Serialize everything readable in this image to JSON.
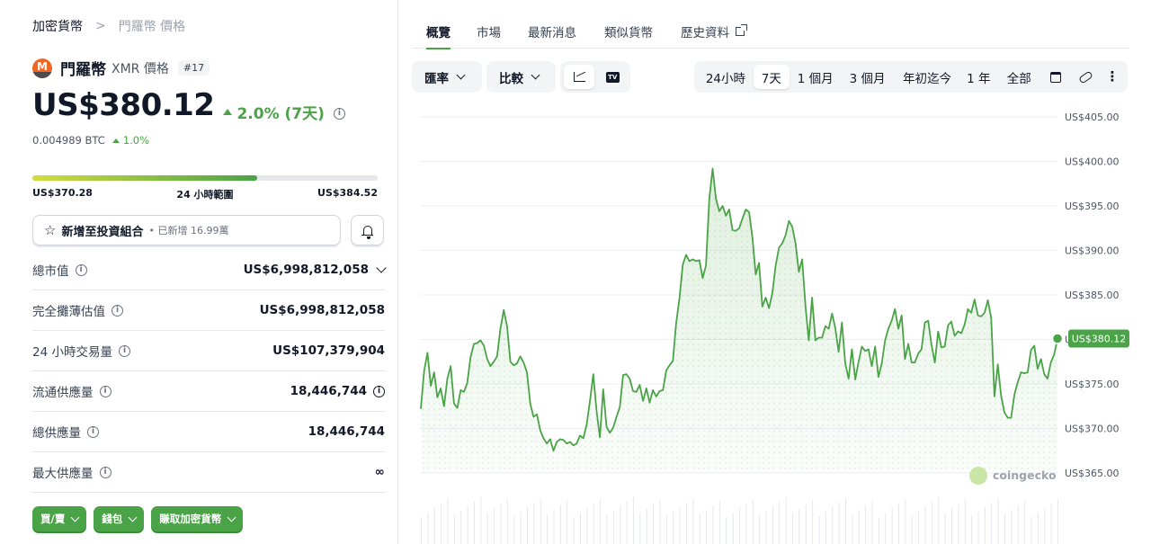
{
  "breadcrumb": {
    "home": "加密貨幣",
    "separator": ">",
    "current": "門羅幣 價格"
  },
  "coin": {
    "name": "門羅幣",
    "symbol": "XMR 價格",
    "rank": "#17",
    "price": "US$380.12",
    "change": "2.0% (7天)",
    "change_direction": "up",
    "btc_price": "0.004989 BTC",
    "btc_change": "1.0%"
  },
  "range": {
    "low": "US$370.28",
    "label": "24 小時範圍",
    "high": "US$384.52",
    "position_fraction": 0.65
  },
  "portfolio": {
    "label": "新增至投資組合",
    "sub": "• 已新增 16.99萬"
  },
  "stats": [
    {
      "label": "總市值",
      "value": "US$6,998,812,058"
    },
    {
      "label": "完全攤薄估值",
      "value": "US$6,998,812,058"
    },
    {
      "label": "24 小時交易量",
      "value": "US$107,379,904"
    },
    {
      "label": "流通供應量",
      "value": "18,446,744"
    },
    {
      "label": "總供應量",
      "value": "18,446,744"
    },
    {
      "label": "最大供應量",
      "value": "∞"
    }
  ],
  "ctas": [
    "買/賣",
    "錢包",
    "賺取加密貨幣"
  ],
  "tabs": [
    "概覽",
    "市場",
    "最新消息",
    "類似貨幣",
    "歷史資料"
  ],
  "active_tab": "概覽",
  "chart_controls": {
    "currency": "匯率",
    "compare": "比較",
    "ranges": [
      "24小時",
      "7天",
      "1 個月",
      "3 個月",
      "年初迄今",
      "1 年",
      "全部"
    ],
    "active_range": "7天"
  },
  "colors": {
    "accent": "#4aa346",
    "text": "#111827",
    "muted": "#6b7280"
  },
  "icons": {
    "chart_type_line": "line-chart-icon",
    "chart_type_tv": "tradingview-icon",
    "calendar": "calendar-icon",
    "share": "link-icon",
    "more": "more-dots-icon"
  },
  "chart_data": {
    "type": "area",
    "ylim": [
      365,
      405
    ],
    "y_ticks": [
      "US$405.00",
      "US$400.00",
      "US$395.00",
      "US$390.00",
      "US$385.00",
      "US$380.00",
      "US$375.00",
      "US$370.00",
      "US$365.00"
    ],
    "y_tick_values": [
      405,
      400,
      395,
      390,
      385,
      380,
      375,
      370,
      365
    ],
    "current_label": "US$380.12",
    "watermark": "coingecko",
    "x_labels": [],
    "values": [
      372.2,
      376.5,
      378.5,
      374.8,
      376.3,
      373.5,
      374.5,
      372.5,
      375.6,
      377.0,
      372.8,
      372.3,
      374.3,
      374.1,
      375.1,
      378.0,
      379.5,
      379.6,
      379.9,
      379.3,
      377.8,
      377.0,
      377.5,
      378.1,
      381.2,
      383.3,
      381.5,
      377.5,
      377.1,
      377.3,
      378.1,
      377.4,
      376.3,
      372.8,
      371.3,
      371.6,
      369.8,
      368.9,
      368.3,
      368.8,
      367.5,
      368.5,
      368.8,
      368.7,
      368.3,
      368.5,
      368.1,
      368.3,
      369.2,
      368.9,
      370.4,
      373.1,
      376.1,
      372.0,
      369.0,
      374.4,
      370.2,
      369.5,
      370.1,
      371.3,
      372.4,
      376.0,
      376.1,
      375.6,
      374.2,
      374.1,
      374.9,
      373.1,
      374.5,
      372.9,
      374.3,
      373.6,
      374.2,
      374.3,
      376.5,
      377.1,
      377.6,
      381.8,
      384.6,
      388.4,
      389.5,
      388.8,
      389.0,
      388.8,
      388.9,
      386.9,
      388.3,
      395.8,
      399.2,
      395.8,
      394.4,
      395.0,
      393.9,
      394.6,
      392.3,
      392.2,
      392.5,
      393.6,
      394.6,
      394.3,
      391.4,
      387.3,
      388.6,
      383.7,
      384.7,
      383.5,
      385.2,
      388.3,
      390.3,
      390.8,
      391.7,
      393.3,
      392.7,
      390.8,
      387.6,
      389.0,
      383.7,
      379.9,
      384.7,
      379.9,
      380.2,
      380.2,
      381.5,
      381.2,
      382.9,
      381.3,
      378.6,
      381.9,
      377.3,
      375.6,
      378.9,
      375.5,
      377.5,
      379.2,
      378.7,
      378.9,
      377.0,
      379.2,
      375.8,
      377.3,
      379.9,
      381.2,
      382.1,
      383.4,
      381.2,
      382.7,
      377.8,
      379.5,
      377.4,
      377.4,
      378.4,
      378.9,
      381.9,
      382.1,
      379.4,
      377.4,
      380.9,
      379.1,
      379.2,
      381.6,
      382.0,
      380.4,
      380.9,
      380.7,
      381.7,
      383.4,
      383.0,
      384.5,
      382.7,
      382.6,
      383.0,
      384.4,
      382.4,
      373.6,
      377.2,
      373.7,
      371.8,
      371.2,
      371.2,
      373.8,
      375.2,
      376.3,
      376.2,
      376.3,
      378.8,
      379.3,
      376.7,
      377.8,
      376.1,
      375.6,
      377.4,
      378.3,
      380.1
    ]
  }
}
